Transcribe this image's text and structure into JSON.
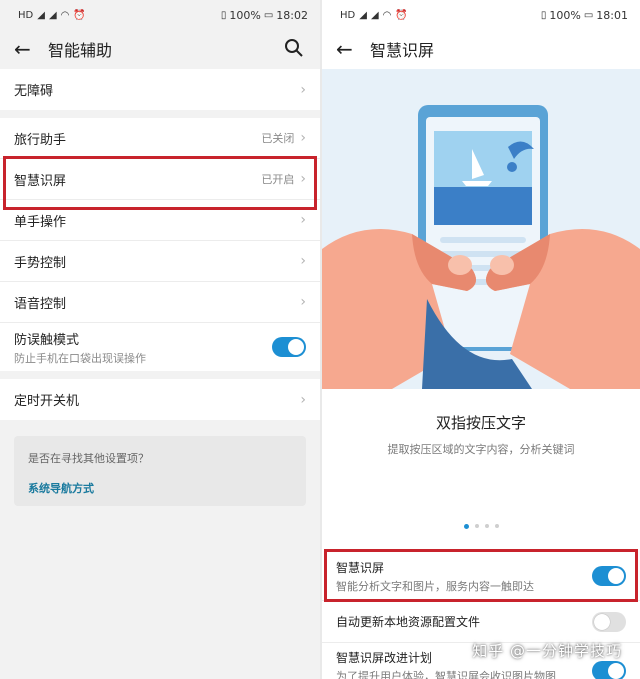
{
  "left": {
    "status": {
      "time": "18:02",
      "battery": "100%"
    },
    "title": "智能辅助",
    "groups": [
      [
        {
          "label": "无障碍",
          "value": ""
        }
      ],
      [
        {
          "label": "旅行助手",
          "value": "已关闭"
        },
        {
          "label": "智慧识屏",
          "value": "已开启"
        },
        {
          "label": "单手操作",
          "value": ""
        },
        {
          "label": "手势控制",
          "value": ""
        },
        {
          "label": "语音控制",
          "value": ""
        }
      ]
    ],
    "anti_touch": {
      "label": "防误触模式",
      "sub": "防止手机在口袋出现误操作",
      "on": true
    },
    "timer": {
      "label": "定时开关机"
    },
    "tip": {
      "question": "是否在寻找其他设置项？",
      "link": "系统导航方式"
    }
  },
  "right": {
    "status": {
      "time": "18:01",
      "battery": "100%"
    },
    "title": "智慧识屏",
    "feature_title": "双指按压文字",
    "feature_sub": "提取按压区域的文字内容，分析关键词",
    "rows": [
      {
        "label": "智慧识屏",
        "sub": "智能分析文字和图片，服务内容一触即达",
        "on": true
      },
      {
        "label": "自动更新本地资源配置文件",
        "sub": "",
        "on": false
      },
      {
        "label": "智慧识屏改进计划",
        "sub": "为了提升用户体验，智慧识屏会收识图片物图",
        "on": true
      }
    ],
    "watermark": "知乎 @一分钟学技巧"
  },
  "colors": {
    "accent": "#1d8fd3",
    "highlight": "#c8232c"
  }
}
